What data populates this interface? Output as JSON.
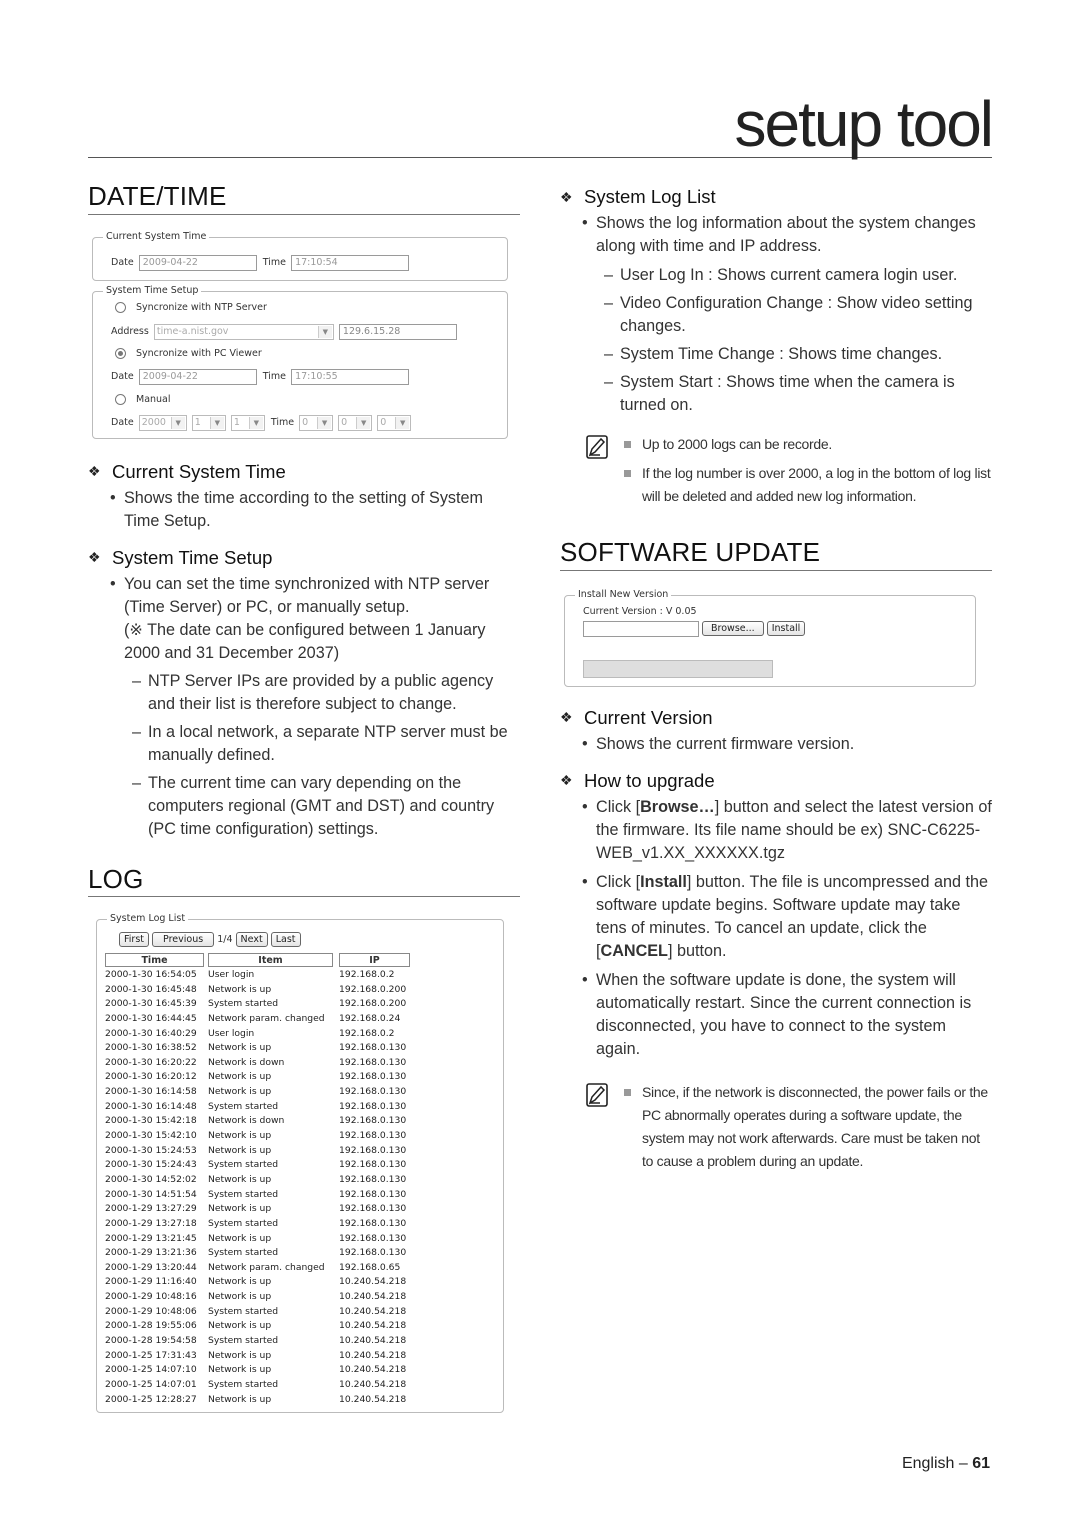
{
  "header": {
    "title": "setup tool"
  },
  "date_time": {
    "heading": "DATE/TIME",
    "ui": {
      "current_system_time": {
        "legend": "Current System Time",
        "date_label": "Date",
        "date_value": "2009-04-22",
        "time_label": "Time",
        "time_value": "17:10:54"
      },
      "system_time_setup": {
        "legend": "System Time Setup",
        "ntp_radio_label": "Syncronize with NTP Server",
        "address_label": "Address",
        "address_value": "time-a.nist.gov",
        "address_ip": "129.6.15.28",
        "pc_radio_label": "Syncronize with PC Viewer",
        "pc_date_label": "Date",
        "pc_date_value": "2009-04-22",
        "pc_time_label": "Time",
        "pc_time_value": "17:10:55",
        "manual_radio_label": "Manual",
        "manual_date_label": "Date",
        "manual_year": "2000",
        "manual_month": "1",
        "manual_day": "1",
        "manual_time_label": "Time",
        "manual_hour": "0",
        "manual_minute": "0",
        "manual_second": "0",
        "selected": "pc"
      }
    },
    "current_system_time": {
      "heading": "Current System Time",
      "bullet": "Shows the time according to the setting of System Time Setup."
    },
    "system_time_setup": {
      "heading": "System Time Setup",
      "bullet": "You can set the time synchronized with NTP server (Time Server) or PC, or manually setup.",
      "note": "(※ The date can be configured between 1 January 2000 and 31 December 2037)",
      "dashes": [
        "NTP Server IPs are provided by a public agency and their list is therefore subject to change.",
        "In a local network, a separate NTP server must be manually defined.",
        "The current time can vary depending on the computers regional (GMT and DST) and country (PC time configuration) settings."
      ]
    }
  },
  "log": {
    "heading": "LOG",
    "ui": {
      "legend": "System Log List",
      "first_label": "First",
      "previous_label": "Previous",
      "page_indicator": "1/4",
      "next_label": "Next",
      "last_label": "Last",
      "columns": [
        "Time",
        "Item",
        "IP"
      ],
      "rows": [
        [
          "2000-1-30 16:54:05",
          "User login",
          "192.168.0.2"
        ],
        [
          "2000-1-30 16:45:48",
          "Network is up",
          "192.168.0.200"
        ],
        [
          "2000-1-30 16:45:39",
          "System started",
          "192.168.0.200"
        ],
        [
          "2000-1-30 16:44:45",
          "Network param. changed",
          "192.168.0.24"
        ],
        [
          "2000-1-30 16:40:29",
          "User login",
          "192.168.0.2"
        ],
        [
          "2000-1-30 16:38:52",
          "Network is up",
          "192.168.0.130"
        ],
        [
          "2000-1-30 16:20:22",
          "Network is down",
          "192.168.0.130"
        ],
        [
          "2000-1-30 16:20:12",
          "Network is up",
          "192.168.0.130"
        ],
        [
          "2000-1-30 16:14:58",
          "Network is up",
          "192.168.0.130"
        ],
        [
          "2000-1-30 16:14:48",
          "System started",
          "192.168.0.130"
        ],
        [
          "2000-1-30 15:42:18",
          "Network is down",
          "192.168.0.130"
        ],
        [
          "2000-1-30 15:42:10",
          "Network is up",
          "192.168.0.130"
        ],
        [
          "2000-1-30 15:24:53",
          "Network is up",
          "192.168.0.130"
        ],
        [
          "2000-1-30 15:24:43",
          "System started",
          "192.168.0.130"
        ],
        [
          "2000-1-30 14:52:02",
          "Network is up",
          "192.168.0.130"
        ],
        [
          "2000-1-30 14:51:54",
          "System started",
          "192.168.0.130"
        ],
        [
          "2000-1-29 13:27:29",
          "Network is up",
          "192.168.0.130"
        ],
        [
          "2000-1-29 13:27:18",
          "System started",
          "192.168.0.130"
        ],
        [
          "2000-1-29 13:21:45",
          "Network is up",
          "192.168.0.130"
        ],
        [
          "2000-1-29 13:21:36",
          "System started",
          "192.168.0.130"
        ],
        [
          "2000-1-29 13:20:44",
          "Network param. changed",
          "192.168.0.65"
        ],
        [
          "2000-1-29 11:16:40",
          "Network is up",
          "10.240.54.218"
        ],
        [
          "2000-1-29 10:48:16",
          "Network is up",
          "10.240.54.218"
        ],
        [
          "2000-1-29 10:48:06",
          "System started",
          "10.240.54.218"
        ],
        [
          "2000-1-28 19:55:06",
          "Network is up",
          "10.240.54.218"
        ],
        [
          "2000-1-28 19:54:58",
          "System started",
          "10.240.54.218"
        ],
        [
          "2000-1-25 17:31:43",
          "Network is up",
          "10.240.54.218"
        ],
        [
          "2000-1-25 14:07:10",
          "Network is up",
          "10.240.54.218"
        ],
        [
          "2000-1-25 14:07:01",
          "System started",
          "10.240.54.218"
        ],
        [
          "2000-1-25 12:28:27",
          "Network is up",
          "10.240.54.218"
        ]
      ]
    },
    "system_log_list": {
      "heading": "System Log List",
      "bullet": "Shows the log information about the system changes along with time and IP address.",
      "dashes": [
        "User Log In : Shows current camera login user.",
        "Video Configuration Change : Show video setting changes.",
        "System Time Change : Shows time changes.",
        "System Start : Shows time when the camera is turned on."
      ],
      "notes": [
        "Up to 2000 logs can be recorde.",
        "If the log number is over 2000, a log in the bottom of log list will be deleted and added new log information."
      ]
    }
  },
  "software_update": {
    "heading": "SOFTWARE UPDATE",
    "ui": {
      "legend": "Install New Version",
      "current_version_label": "Current Version : V 0.05",
      "file_value": "",
      "browse_label": "Browse...",
      "install_label": "Install",
      "progress": 0
    },
    "current_version": {
      "heading": "Current Version",
      "bullet": "Shows the current firmware version."
    },
    "how_to_upgrade": {
      "heading": "How to upgrade",
      "b1_pre": "Click [",
      "b1_bold": "Browse…",
      "b1_post": "] button and select the latest version of the firmware. Its file name should be ex) SNC-C6225-WEB_v1.XX_XXXXXX.tgz",
      "b2_pre": "Click [",
      "b2_bold": "Install",
      "b2_mid": "] button. The file is uncompressed and the software update begins. Software update may take tens of minutes. To cancel an update, click the [",
      "b2_bold2": "CANCEL",
      "b2_post": "] button.",
      "b3": "When the software update is done, the system will automatically restart. Since the current connection is disconnected, you have to connect to the system again.",
      "note": "Since, if the network is disconnected, the power fails or the PC abnormally operates during a software update, the system may not work afterwards. Care must be taken not to cause a problem during an update."
    }
  },
  "footer": {
    "language": "English – ",
    "page_number": "61"
  }
}
